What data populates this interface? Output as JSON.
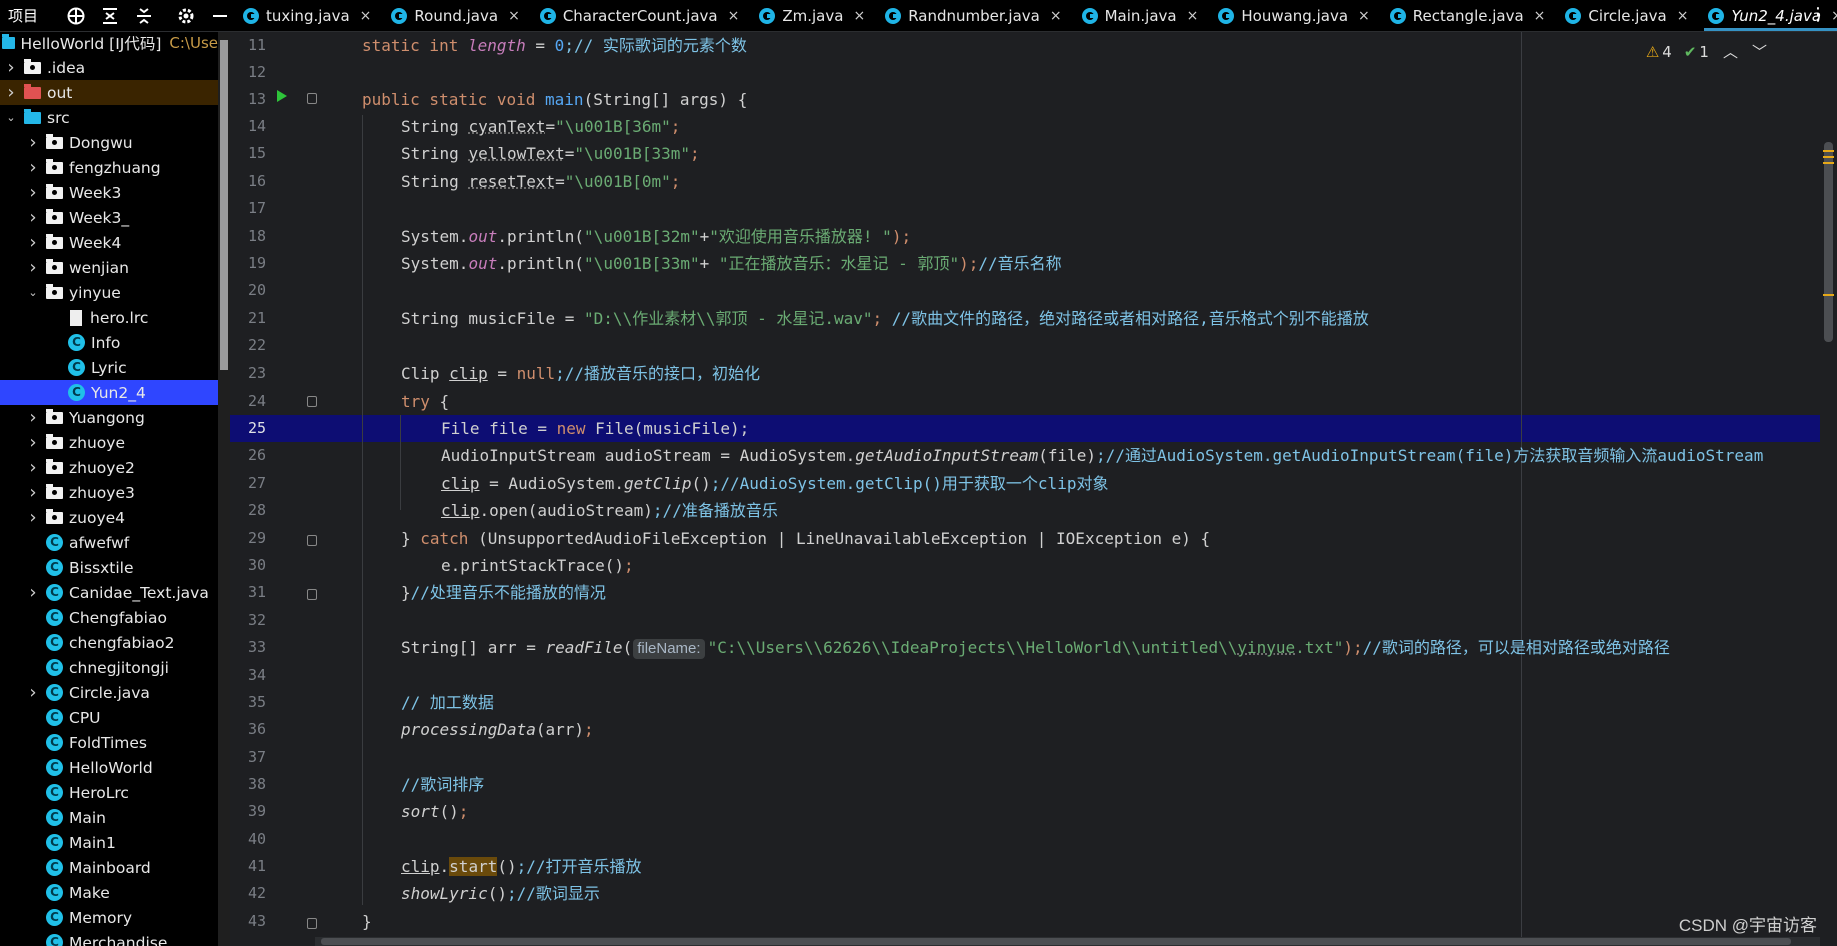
{
  "toolbar": {
    "project_label": "项目"
  },
  "tabs": [
    {
      "label": "tuxing.java"
    },
    {
      "label": "Round.java"
    },
    {
      "label": "CharacterCount.java"
    },
    {
      "label": "Zm.java"
    },
    {
      "label": "Randnumber.java"
    },
    {
      "label": "Main.java"
    },
    {
      "label": "Houwang.java"
    },
    {
      "label": "Rectangle.java"
    },
    {
      "label": "Circle.java"
    },
    {
      "label": "Yun2_4.java"
    }
  ],
  "tab_close_glyph": "×",
  "project_tree": {
    "root": {
      "label": "HelloWorld [IJ代码]",
      "path": "C:\\Use"
    },
    "items": [
      {
        "label": ".idea"
      },
      {
        "label": "out"
      },
      {
        "label": "src"
      },
      {
        "label": "Dongwu"
      },
      {
        "label": "fengzhuang"
      },
      {
        "label": "Week3"
      },
      {
        "label": "Week3_"
      },
      {
        "label": "Week4"
      },
      {
        "label": "wenjian"
      },
      {
        "label": "yinyue"
      },
      {
        "label": "hero.lrc"
      },
      {
        "label": "Info"
      },
      {
        "label": "Lyric"
      },
      {
        "label": "Yun2_4"
      },
      {
        "label": "Yuangong"
      },
      {
        "label": "zhuoye"
      },
      {
        "label": "zhuoye2"
      },
      {
        "label": "zhuoye3"
      },
      {
        "label": "zuoye4"
      },
      {
        "label": "afwefwf"
      },
      {
        "label": "Bissxtile"
      },
      {
        "label": "Canidae_Text.java"
      },
      {
        "label": "Chengfabiao"
      },
      {
        "label": "chengfabiao2"
      },
      {
        "label": "chnegjitongji"
      },
      {
        "label": "Circle.java"
      },
      {
        "label": "CPU"
      },
      {
        "label": "FoldTimes"
      },
      {
        "label": "HelloWorld"
      },
      {
        "label": "HeroLrc"
      },
      {
        "label": "Main"
      },
      {
        "label": "Main1"
      },
      {
        "label": "Mainboard"
      },
      {
        "label": "Make"
      },
      {
        "label": "Memory"
      },
      {
        "label": "Merchandise"
      }
    ]
  },
  "line_numbers": [
    "11",
    "12",
    "13",
    "14",
    "15",
    "16",
    "17",
    "18",
    "19",
    "20",
    "21",
    "22",
    "23",
    "24",
    "25",
    "26",
    "27",
    "28",
    "29",
    "30",
    "31",
    "32",
    "33",
    "34",
    "35",
    "36",
    "37",
    "38",
    "39",
    "40",
    "41",
    "42",
    "43"
  ],
  "inspections": {
    "warnings": "4",
    "ok": "1"
  },
  "code": {
    "l11_kw": "static int ",
    "l11_fld": "length",
    "l11_rest": " = ",
    "l11_num": "0",
    "l11_cmt": ";// 实际歌词的元素个数",
    "l13_kw": "public static void ",
    "l13_fn": "main",
    "l13_rest": "(String[] args) {",
    "l14_a": "String ",
    "l14_v": "cyanText",
    "l14_b": "=",
    "l14_s": "\"\\u001B[36m\"",
    "l14_c": ";",
    "l15_a": "String ",
    "l15_v": "yellowText",
    "l15_b": "=",
    "l15_s": "\"\\u001B[33m\"",
    "l15_c": ";",
    "l16_a": "String ",
    "l16_v": "resetText",
    "l16_b": "=",
    "l16_s": "\"\\u001B[0m\"",
    "l16_c": ";",
    "l18_a": "System.",
    "l18_f": "out",
    "l18_b": ".println(",
    "l18_s1": "\"\\u001B[32m\"",
    "l18_p": "+",
    "l18_s2": "\"欢迎使用音乐播放器! \"",
    "l18_c": ");",
    "l19_a": "System.",
    "l19_f": "out",
    "l19_b": ".println(",
    "l19_s1": "\"\\u001B[33m\"",
    "l19_p": "+ ",
    "l19_s2": "\"正在播放音乐：水星记 - 郭顶\"",
    "l19_c": ");",
    "l19_cm": "//音乐名称",
    "l21_a": "String musicFile = ",
    "l21_s": "\"D:\\\\作业素材\\\\郭顶 - 水星记.wav\"",
    "l21_c": "; ",
    "l21_cm": "//歌曲文件的路径，绝对路径或者相对路径,音乐格式个别不能播放",
    "l23_a": "Clip ",
    "l23_v": "clip",
    "l23_b": " = ",
    "l23_k": "null",
    "l23_cm": ";//播放音乐的接口，初始化",
    "l24_k": "try",
    "l24_b": " {",
    "l25_a": "File file = ",
    "l25_k": "new",
    "l25_b": " File(musicFile);",
    "l26_a": "AudioInputStream audioStream = AudioSystem.",
    "l26_m": "getAudioInputStream",
    "l26_b": "(file)",
    "l26_cm": ";//通过AudioSystem.getAudioInputStream(file)方法获取音频输入流audioStream",
    "l27_v": "clip",
    "l27_a": " = AudioSystem.",
    "l27_m": "getClip",
    "l27_b": "()",
    "l27_cm": ";//AudioSystem.getClip()用于获取一个clip对象",
    "l28_v": "clip",
    "l28_a": ".open(audioStream)",
    "l28_cm": ";//准备播放音乐",
    "l29_a": "} ",
    "l29_k": "catch",
    "l29_b": " (UnsupportedAudioFileException | LineUnavailableException | IOException e) {",
    "l30_a": "e.printStackTrace()",
    "l30_c": ";",
    "l31_a": "}",
    "l31_cm": "//处理音乐不能播放的情况",
    "l33_a": "String[] arr = ",
    "l33_m": "readFile",
    "l33_b": "(",
    "l33_hint": "fileName:",
    "l33_s1": "\"C:\\\\Users\\\\62626\\\\IdeaProjects\\\\HelloWorld\\\\untitled\\\\",
    "l33_s2": "yinyue",
    "l33_s3": ".txt\"",
    "l33_c": ");",
    "l33_cm": "//歌词的路径，可以是相对路径或绝对路径",
    "l35_cm": "// 加工数据",
    "l36_m": "processingData",
    "l36_b": "(arr)",
    "l36_c": ";",
    "l38_cm": "//歌词排序",
    "l39_m": "sort",
    "l39_b": "()",
    "l39_c": ";",
    "l41_v": "clip",
    "l41_a": ".",
    "l41_m": "start",
    "l41_b": "()",
    "l41_cm": ";//打开音乐播放",
    "l42_m": "showLyric",
    "l42_b": "()",
    "l42_cm": ";//歌词显示",
    "l43_a": "}"
  },
  "watermark": "CSDN @宇宙访客"
}
